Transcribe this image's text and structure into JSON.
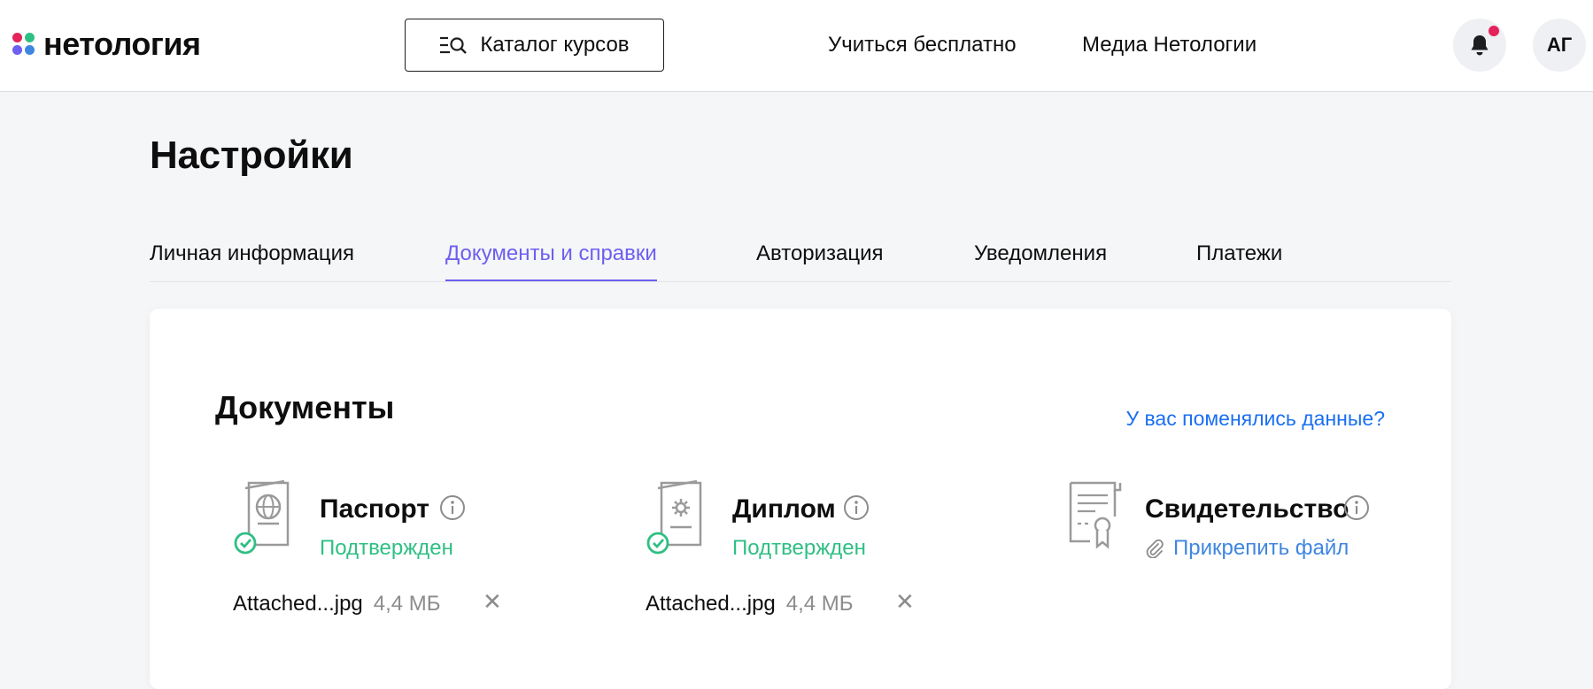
{
  "header": {
    "logo_text": "нетология",
    "catalog_label": "Каталог курсов",
    "nav": [
      "Учиться бесплатно",
      "Медиа Нетологии"
    ],
    "avatar_initials": "АГ"
  },
  "page": {
    "title": "Настройки",
    "tabs": [
      {
        "label": "Личная информация",
        "active": false
      },
      {
        "label": "Документы и справки",
        "active": true
      },
      {
        "label": "Авторизация",
        "active": false
      },
      {
        "label": "Уведомления",
        "active": false
      },
      {
        "label": "Платежи",
        "active": false
      }
    ]
  },
  "documents": {
    "title": "Документы",
    "change_link": "У вас поменялись данные?",
    "items": [
      {
        "name": "Паспорт",
        "status": "Подтвержден",
        "file_name": "Attached...jpg",
        "file_size": "4,4 МБ",
        "icon": "passport-icon"
      },
      {
        "name": "Диплом",
        "status": "Подтвержден",
        "file_name": "Attached...jpg",
        "file_size": "4,4 МБ",
        "icon": "diploma-icon"
      },
      {
        "name": "Свидетельство",
        "attach_label": "Прикрепить файл",
        "icon": "certificate-icon"
      }
    ]
  },
  "colors": {
    "accent": "#6e5ff0",
    "link": "#1a6ff0",
    "success": "#2fbf84",
    "notification": "#e4225b",
    "logo_dots": [
      "#e4225b",
      "#2fbf84",
      "#6e5ff0",
      "#3f86e0"
    ]
  }
}
